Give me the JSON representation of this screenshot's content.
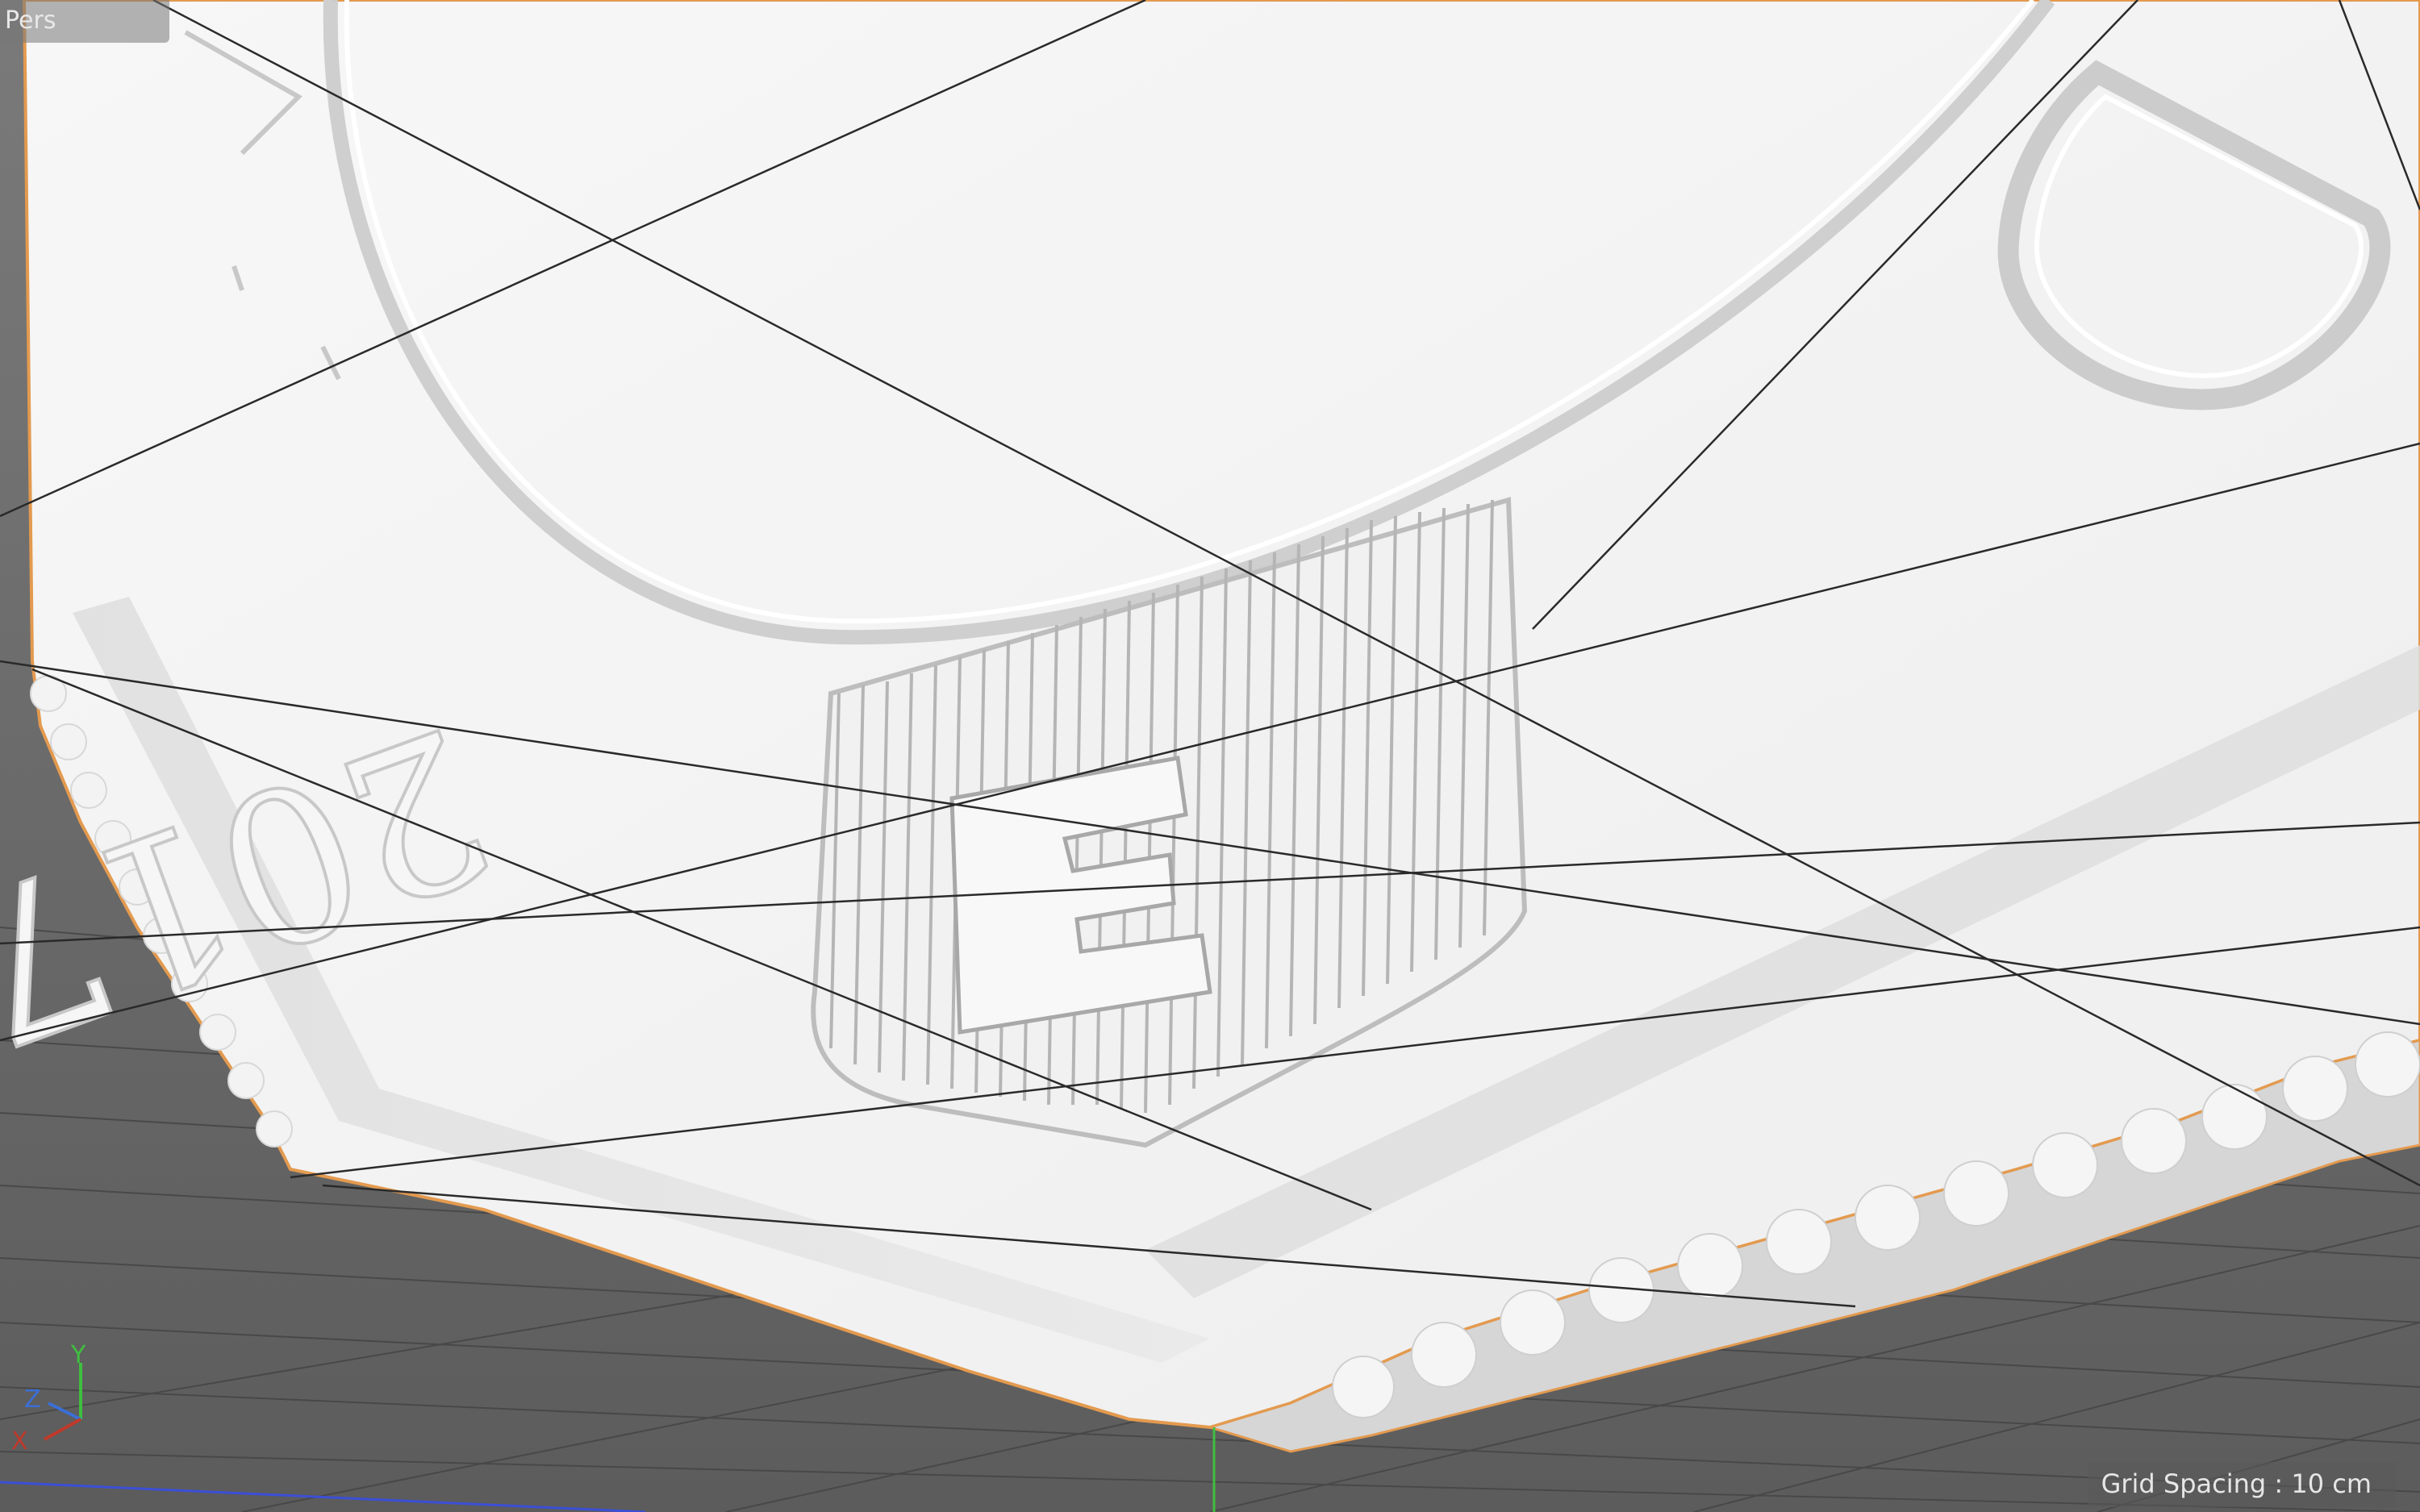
{
  "viewport": {
    "camera_label": "Pers",
    "grid_spacing_label": "Grid Spacing : 10 cm"
  },
  "axis_gizmo": {
    "y_label": "Y",
    "z_label": "Z",
    "x_label": "X",
    "colors": {
      "x": "#c0392b",
      "y": "#3fbf3f",
      "z": "#3b6fd6"
    }
  },
  "model": {
    "engraved_text": "2017",
    "surface_color": "#f3f3f3",
    "selection_edge_color": "#e39a4f"
  }
}
